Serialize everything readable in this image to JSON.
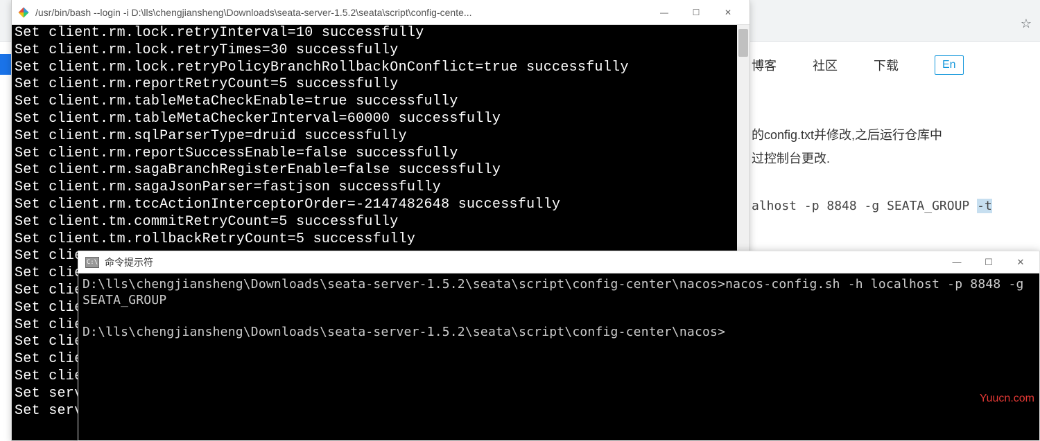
{
  "browser": {
    "star_symbol": "☆",
    "nav": {
      "blog": "博客",
      "community": "社区",
      "download": "下载",
      "lang": "En"
    },
    "doc_line1": "的config.txt并修改,之后运行仓库中",
    "doc_line2": "过控制台更改.",
    "code_part": "alhost -p 8848 -g SEATA_GROUP ",
    "code_tail": "-t"
  },
  "win1": {
    "title": "/usr/bin/bash --login -i D:\\lls\\chengjiansheng\\Downloads\\seata-server-1.5.2\\seata\\script\\config-cente...",
    "lines": [
      "Set client.rm.lock.retryInterval=10 successfully",
      "Set client.rm.lock.retryTimes=30 successfully",
      "Set client.rm.lock.retryPolicyBranchRollbackOnConflict=true successfully",
      "Set client.rm.reportRetryCount=5 successfully",
      "Set client.rm.tableMetaCheckEnable=true successfully",
      "Set client.rm.tableMetaCheckerInterval=60000 successfully",
      "Set client.rm.sqlParserType=druid successfully",
      "Set client.rm.reportSuccessEnable=false successfully",
      "Set client.rm.sagaBranchRegisterEnable=false successfully",
      "Set client.rm.sagaJsonParser=fastjson successfully",
      "Set client.rm.tccActionInterceptorOrder=-2147482648 successfully",
      "Set client.tm.commitRetryCount=5 successfully",
      "Set client.tm.rollbackRetryCount=5 successfully",
      "Set clien",
      "Set clien",
      "Set clien",
      "Set clien",
      "Set clien",
      "Set clien",
      "Set clien",
      "Set clien",
      "Set serve",
      "Set serve"
    ]
  },
  "win2": {
    "title": "命令提示符",
    "icon_text": "C:\\",
    "prompt1": "D:\\lls\\chengjiansheng\\Downloads\\seata-server-1.5.2\\seata\\script\\config-center\\nacos>nacos-config.sh -h localhost -p 8848 -g SEATA_GROUP",
    "prompt2": "D:\\lls\\chengjiansheng\\Downloads\\seata-server-1.5.2\\seata\\script\\config-center\\nacos>"
  },
  "controls": {
    "min": "—",
    "max": "☐",
    "close": "✕"
  },
  "watermark": "Yuucn.com"
}
